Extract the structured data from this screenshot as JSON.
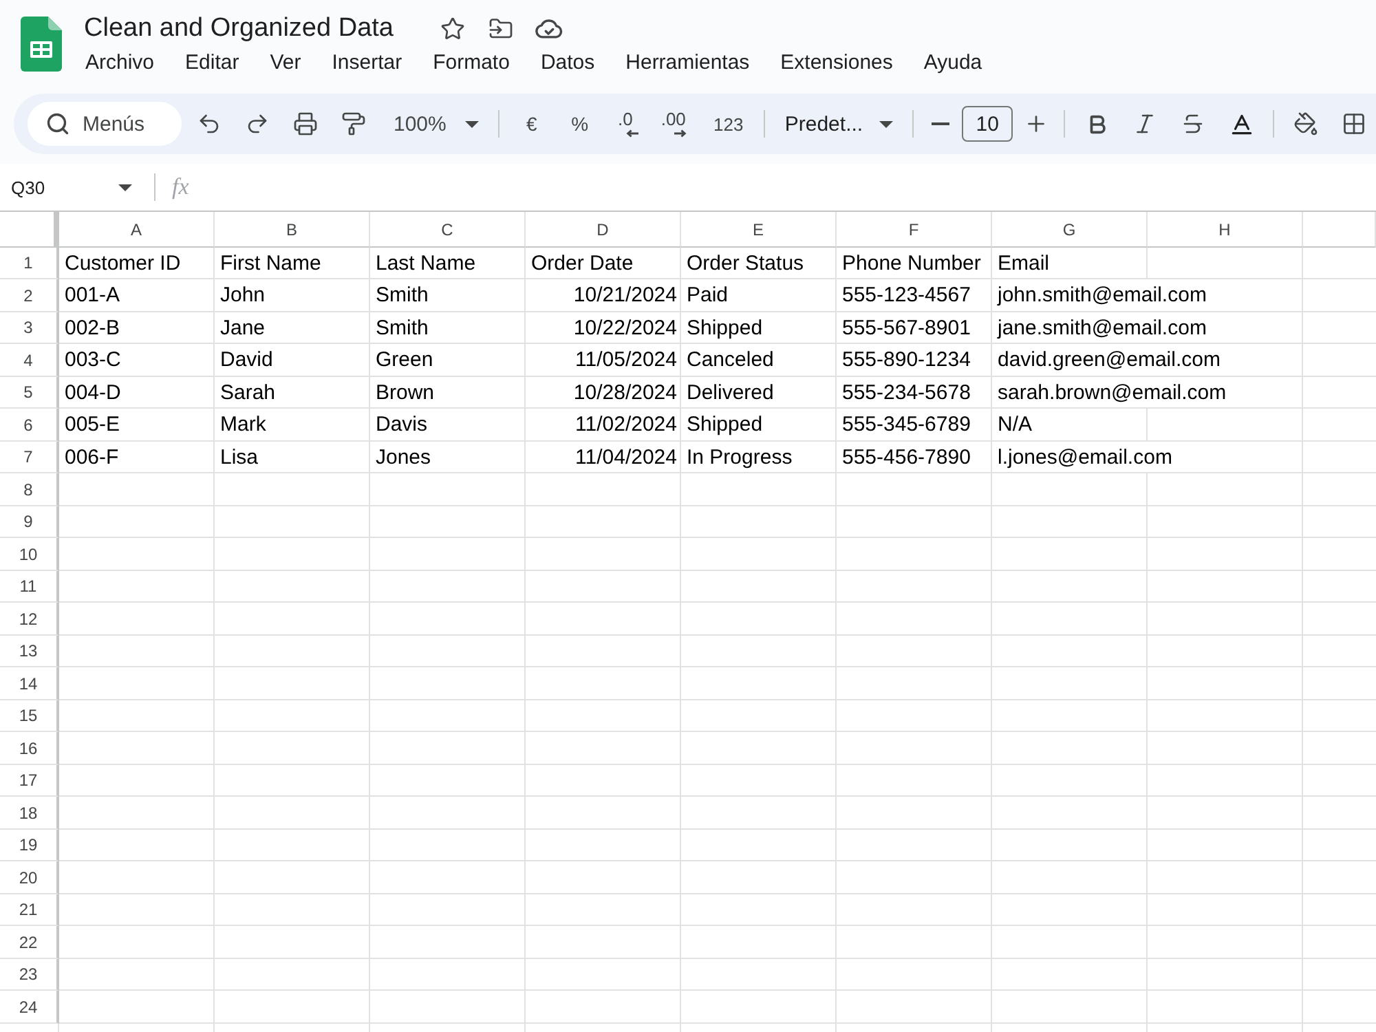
{
  "app": {
    "title": "Clean and Organized Data",
    "menu": [
      "Archivo",
      "Editar",
      "Ver",
      "Insertar",
      "Formato",
      "Datos",
      "Herramientas",
      "Extensiones",
      "Ayuda"
    ]
  },
  "toolbar": {
    "search": {
      "placeholder": "Menús"
    },
    "zoom": "100%",
    "currency": "€",
    "percent": "%",
    "decrease_decimals": ".0",
    "increase_decimals": ".00",
    "number_format": "123",
    "font": "Predet...",
    "font_size": "10"
  },
  "formula_bar": {
    "cell_reference": "Q30",
    "function_label": "fx"
  },
  "sheet": {
    "columns": [
      "A",
      "B",
      "C",
      "D",
      "E",
      "F",
      "G",
      "H"
    ],
    "rows": [
      {
        "number": "1",
        "cells": [
          {
            "value": "Customer ID",
            "kind": "text"
          },
          {
            "value": "First Name",
            "kind": "text"
          },
          {
            "value": "Last Name",
            "kind": "text"
          },
          {
            "value": "Order Date",
            "kind": "text"
          },
          {
            "value": "Order Status",
            "kind": "text"
          },
          {
            "value": "Phone Number",
            "kind": "text"
          },
          {
            "value": "Email",
            "kind": "text"
          }
        ]
      },
      {
        "number": "2",
        "cells": [
          {
            "value": "001-A",
            "kind": "text"
          },
          {
            "value": "John",
            "kind": "text"
          },
          {
            "value": "Smith",
            "kind": "text"
          },
          {
            "value": "10/21/2024",
            "kind": "date"
          },
          {
            "value": "Paid",
            "kind": "text"
          },
          {
            "value": "555-123-4567",
            "kind": "text"
          },
          {
            "value": "john.smith@email.com",
            "kind": "text"
          }
        ]
      },
      {
        "number": "3",
        "cells": [
          {
            "value": "002-B",
            "kind": "text"
          },
          {
            "value": "Jane",
            "kind": "text"
          },
          {
            "value": "Smith",
            "kind": "text"
          },
          {
            "value": "10/22/2024",
            "kind": "date"
          },
          {
            "value": "Shipped",
            "kind": "text"
          },
          {
            "value": "555-567-8901",
            "kind": "text"
          },
          {
            "value": "jane.smith@email.com",
            "kind": "text"
          }
        ]
      },
      {
        "number": "4",
        "cells": [
          {
            "value": "003-C",
            "kind": "text"
          },
          {
            "value": "David",
            "kind": "text"
          },
          {
            "value": "Green",
            "kind": "text"
          },
          {
            "value": "11/05/2024",
            "kind": "date"
          },
          {
            "value": "Canceled",
            "kind": "text"
          },
          {
            "value": "555-890-1234",
            "kind": "text"
          },
          {
            "value": "david.green@email.com",
            "kind": "text"
          }
        ]
      },
      {
        "number": "5",
        "cells": [
          {
            "value": "004-D",
            "kind": "text"
          },
          {
            "value": "Sarah",
            "kind": "text"
          },
          {
            "value": "Brown",
            "kind": "text"
          },
          {
            "value": "10/28/2024",
            "kind": "date"
          },
          {
            "value": "Delivered",
            "kind": "text"
          },
          {
            "value": "555-234-5678",
            "kind": "text"
          },
          {
            "value": "sarah.brown@email.com",
            "kind": "text"
          }
        ]
      },
      {
        "number": "6",
        "cells": [
          {
            "value": "005-E",
            "kind": "text"
          },
          {
            "value": "Mark",
            "kind": "text"
          },
          {
            "value": "Davis",
            "kind": "text"
          },
          {
            "value": "11/02/2024",
            "kind": "date"
          },
          {
            "value": "Shipped",
            "kind": "text"
          },
          {
            "value": "555-345-6789",
            "kind": "text"
          },
          {
            "value": "N/A",
            "kind": "text"
          }
        ]
      },
      {
        "number": "7",
        "cells": [
          {
            "value": "006-F",
            "kind": "text"
          },
          {
            "value": "Lisa",
            "kind": "text"
          },
          {
            "value": "Jones",
            "kind": "text"
          },
          {
            "value": "11/04/2024",
            "kind": "date"
          },
          {
            "value": "In Progress",
            "kind": "text"
          },
          {
            "value": "555-456-7890",
            "kind": "text"
          },
          {
            "value": "l.jones@email.com",
            "kind": "text"
          }
        ]
      },
      {
        "number": "8"
      },
      {
        "number": "9"
      },
      {
        "number": "10"
      },
      {
        "number": "11"
      },
      {
        "number": "12"
      },
      {
        "number": "13"
      },
      {
        "number": "14"
      },
      {
        "number": "15"
      },
      {
        "number": "16"
      },
      {
        "number": "17"
      },
      {
        "number": "18"
      },
      {
        "number": "19"
      },
      {
        "number": "20"
      },
      {
        "number": "21"
      },
      {
        "number": "22"
      },
      {
        "number": "23"
      },
      {
        "number": "24"
      }
    ]
  }
}
